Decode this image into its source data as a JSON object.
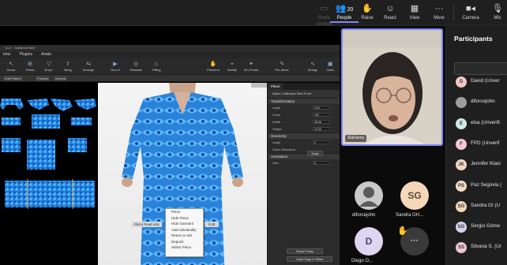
{
  "toolbar": {
    "share_content": "Share content",
    "people": "People",
    "people_count": "20",
    "raise": "Raise",
    "react": "React",
    "view": "View",
    "more": "More",
    "camera": "Camera",
    "mic": "Mic"
  },
  "shared_app": {
    "menu": [
      "ions",
      "Plugins",
      "Avata"
    ],
    "tools": [
      "Arrow",
      "Pixels",
      "Drop+",
      "Bring",
      "Arrange",
      "Run H",
      "Simulate",
      "Fitting",
      "Preserve",
      "Modify",
      "Pin-Points",
      "Pin-Items",
      "Fitting",
      "Stitching",
      "Strings",
      "Cloth"
    ],
    "tabs": [
      "Edit Pattern",
      "Preview",
      "Internal"
    ],
    "property_tabs": [
      "Piece"
    ],
    "piece_name": "Name: Gathered Skirt Front",
    "sections": [
      "Transformation",
      "Geometry",
      "Annotation"
    ],
    "rows": [
      "Angle",
      "Scale",
      "Width",
      "Height",
      "Angle",
      "Seam Allowance",
      "Size"
    ],
    "context_tag": "Fold Before",
    "left_tag": "Piece Read only",
    "right_tag": "Fold",
    "context_menu": [
      "Piece",
      "Hide Piece",
      "Hide Garment",
      "Add Individually",
      "Return to Ws",
      "Deposit",
      "Select Piece"
    ],
    "buttons": [
      "Apply",
      "Reset Points",
      "Close Edge & Offset"
    ]
  },
  "gallery": {
    "spotlight_name": "XiuFanny",
    "tiles": [
      {
        "name": "diforcejohn",
        "initials": "",
        "color": "#c9c9c9"
      },
      {
        "name": "Sandra GH...",
        "initials": "SG",
        "color": "#f3d7b8"
      },
      {
        "name": "Diego O...",
        "initials": "D",
        "color": "#dcd6f0"
      }
    ]
  },
  "participants": {
    "title": "Participants",
    "list": [
      {
        "initials": "D",
        "name": "David (Unver",
        "color": "#f3c6c6"
      },
      {
        "initials": "",
        "name": "diforcejohn",
        "color": "#9d9d9d"
      },
      {
        "initials": "E",
        "name": "elsa (Unverifi",
        "color": "#cfe8e8"
      },
      {
        "initials": "F",
        "name": "FPD (Unverif",
        "color": "#f6c6d6"
      },
      {
        "initials": "JK",
        "name": "Jennifer Klasi",
        "color": "#f3d7c2"
      },
      {
        "initials": "PS",
        "name": "Paz Segovia (",
        "color": "#f3dcc6"
      },
      {
        "initials": "SG",
        "name": "Sandra GI (U",
        "color": "#f3d7b8"
      },
      {
        "initials": "SG",
        "name": "Sergio Góme",
        "color": "#d5d0ee"
      },
      {
        "initials": "SS",
        "name": "Silvana S. (Ur",
        "color": "#efc7d6"
      }
    ]
  }
}
